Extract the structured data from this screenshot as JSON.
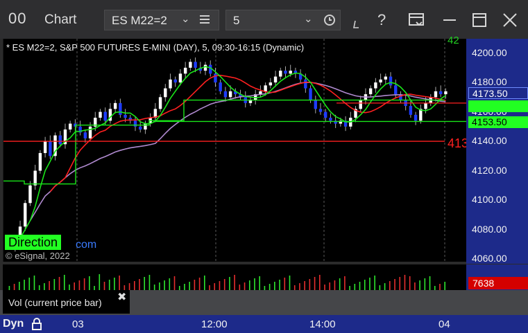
{
  "window": {
    "logo": "00",
    "title": "Chart",
    "symbol_value": "ES M22=2",
    "interval_value": "5"
  },
  "chart": {
    "description": "* ES M22=2, S&P 500 FUTURES E-MINI (DAY), 5, 09:30-16:15 (Dynamic)",
    "copyright": "© eSignal, 2022",
    "direction_label": "Direction",
    "direction_tail": "com",
    "price_badges": {
      "last_price": "4173.50",
      "green_line": "4153.50",
      "red_line_partial": "413",
      "top_partial": "42"
    }
  },
  "chart_data": {
    "type": "candlestick",
    "y_ticks": [
      "4200.00",
      "4180.00",
      "4160.00",
      "4140.00",
      "4120.00",
      "4100.00",
      "4080.00",
      "4060.00"
    ],
    "x_ticks": [
      "03",
      "12:00",
      "14:00",
      "04"
    ],
    "ylim": [
      4060,
      4205
    ],
    "closes": [
      4072,
      4068,
      4082,
      4098,
      4110,
      4120,
      4132,
      4140,
      4130,
      4144,
      4138,
      4148,
      4152,
      4150,
      4146,
      4142,
      4150,
      4156,
      4160,
      4154,
      4162,
      4166,
      4158,
      4156,
      4154,
      4150,
      4148,
      4152,
      4156,
      4162,
      4170,
      4176,
      4182,
      4180,
      4186,
      4190,
      4194,
      4190,
      4188,
      4192,
      4186,
      4180,
      4174,
      4170,
      4174,
      4172,
      4170,
      4166,
      4168,
      4172,
      4174,
      4178,
      4180,
      4184,
      4188,
      4186,
      4188,
      4186,
      4182,
      4176,
      4168,
      4162,
      4160,
      4156,
      4154,
      4152,
      4154,
      4150,
      4156,
      4162,
      4168,
      4172,
      4176,
      4180,
      4182,
      4184,
      4178,
      4172,
      4168,
      4164,
      4158,
      4154,
      4162,
      4166,
      4170,
      4174,
      4172,
      4174
    ]
  },
  "volume": {
    "legend_label": "Vol (current price bar)",
    "close_glyph": "✖",
    "value": "7638"
  },
  "timebar": {
    "mode_label": "Dyn"
  },
  "colors": {
    "up": "#ffffff",
    "down": "#1e3cff",
    "ma_green": "#19e619",
    "ma_red": "#ff2020",
    "ma_purple": "#b08ad0",
    "badge_last": "#1d2a8a",
    "badge_green": "#22ff22"
  }
}
